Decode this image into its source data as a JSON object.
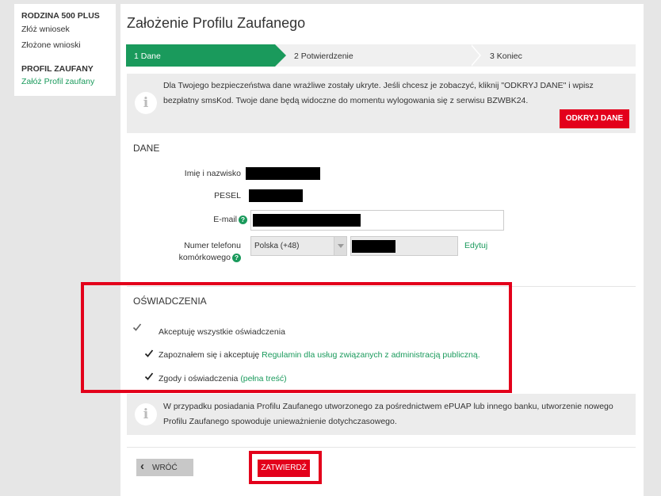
{
  "sidebar": {
    "section1_title": "RODZINA 500 PLUS",
    "item1": "Złóż wniosek",
    "item2": "Złożone wnioski",
    "section2_title": "PROFIL ZAUFANY",
    "item3": "Załóż Profil zaufany"
  },
  "page_title": "Założenie Profilu Zaufanego",
  "steps": [
    "1 Dane",
    "2 Potwierdzenie",
    "3 Koniec"
  ],
  "info1": {
    "text": "Dla Twojego bezpieczeństwa dane wrażliwe zostały ukryte. Jeśli chcesz je zobaczyć, kliknij \"ODKRYJ DANE\" i wpisz bezpłatny smsKod. Twoje dane będą widoczne do momentu wylogowania się z serwisu BZWBK24.",
    "button": "ODKRYJ DANE"
  },
  "dane": {
    "title": "DANE",
    "name_label": "Imię i nazwisko",
    "pesel_label": "PESEL",
    "email_label": "E-mail",
    "phone_label_1": "Numer telefonu",
    "phone_label_2": "komórkowego",
    "country_value": "Polska (+48)",
    "edit_link": "Edytuj",
    "help_glyph": "?"
  },
  "oswiadczenia": {
    "title": "OŚWIADCZENIA",
    "accept_all": "Akceptuję wszystkie oświadczenia",
    "regulamin_prefix": "Zapoznałem się i akceptuję",
    "regulamin_link": "Regulamin dla usług związanych z administracją publiczną.",
    "zgody_prefix": "Zgody i oświadczenia",
    "zgody_link": "(pełna treść)"
  },
  "info2": {
    "text": "W przypadku posiadania Profilu Zaufanego utworzonego za pośrednictwem ePUAP lub innego banku, utworzenie nowego Profilu Zaufanego spowoduje unieważnienie dotychczasowego."
  },
  "buttons": {
    "back": "WRÓĆ",
    "back_glyph": "‹",
    "confirm": "ZATWIERDŹ"
  },
  "info_glyph": "i",
  "colors": {
    "accent_green": "#1a9a5c",
    "action_red": "#e3001b",
    "highlight_red": "#e3001b"
  }
}
